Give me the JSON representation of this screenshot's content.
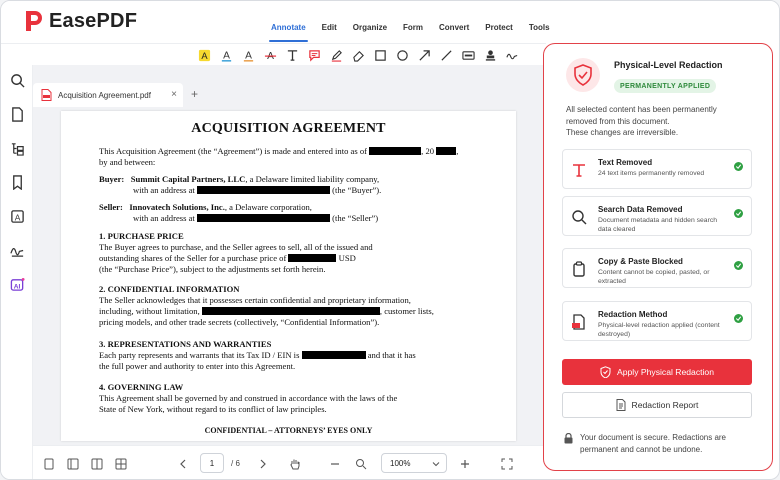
{
  "app": {
    "name": "EasePDF"
  },
  "menu": [
    {
      "label": "Annotate",
      "active": true
    },
    {
      "label": "Edit"
    },
    {
      "label": "Organize"
    },
    {
      "label": "Form"
    },
    {
      "label": "Convert"
    },
    {
      "label": "Protect"
    },
    {
      "label": "Tools"
    }
  ],
  "tab": {
    "label": "Acquisition Agreement.pdf",
    "close": "×",
    "add": "+"
  },
  "doc": {
    "title": "ACQUISITION AGREEMENT",
    "intro1a": "This Acquisition Agreement (the “Agreement”) is made and entered into as of",
    "intro1b": ", 20",
    "intro1c": ",",
    "intro2": "by and between:",
    "buyer_label": "Buyer:",
    "buyer_name": "Summit Capital Partners, LLC",
    "buyer_desc": ", a Delaware limited liability company,",
    "buyer_addr_a": "with an address at",
    "buyer_addr_b": "(the “Buyer”).",
    "seller_label": "Seller:",
    "seller_name": "Innovatech Solutions, Inc.",
    "seller_desc": ", a Delaware corporation,",
    "seller_addr_a": "with an address at",
    "seller_addr_b": "(the “Seller”)",
    "s1_title": "1. PURCHASE PRICE",
    "s1_l1": "The Buyer agrees to purchase, and the Seller agrees to sell, all of the issued and",
    "s1_l2a": "outstanding shares of the Seller for a purchase price of",
    "s1_l2b": "USD",
    "s1_l3": "(the “Purchase Price”), subject to the adjustments set forth herein.",
    "s2_title": "2. CONFIDENTIAL INFORMATION",
    "s2_l1": "The Seller acknowledges that it possesses certain confidential and proprietary information,",
    "s2_l2a": "including, without limitation,",
    "s2_l2b": ", customer lists,",
    "s2_l3": "pricing models, and other trade secrets (collectively, “Confidential Information”).",
    "s3_title": "3. REPRESENTATIONS AND WARRANTIES",
    "s3_l1a": "Each party represents and warrants that its Tax ID / EIN is",
    "s3_l1b": "and that it has",
    "s3_l2": "the full power and authority to enter into this Agreement.",
    "s4_title": "4. GOVERNING LAW",
    "s4_l1": "This Agreement shall be governed by and construed in accordance with the laws of the",
    "s4_l2": "State of New York, without regard to its conflict of law principles.",
    "footer": "CONFIDENTIAL – ATTORNEYS’ EYES ONLY"
  },
  "pager": {
    "current": "1",
    "total": "/ 6"
  },
  "zoom": {
    "value": "100%"
  },
  "panel": {
    "title": "Physical-Level Redaction",
    "badge": "PERMANENTLY APPLIED",
    "desc1": "All selected content has been permanently",
    "desc2": "removed from this document.",
    "desc3": "These changes are irreversible.",
    "cards": [
      {
        "title": "Text Removed",
        "sub": "24 text items permanently removed"
      },
      {
        "title": "Search Data Removed",
        "sub": "Document metadata and hidden search data cleared"
      },
      {
        "title": "Copy & Paste Blocked",
        "sub": "Content cannot be copied, pasted, or extracted"
      },
      {
        "title": "Redaction Method",
        "sub": "Physical-level redaction applied (content destroyed)"
      }
    ],
    "apply_label": "Apply Physical Redaction",
    "report_label": "Redaction Report",
    "secure_text": "Your document is secure. Redactions are permanent and cannot be undone."
  },
  "colors": {
    "accent": "#2f6fd6",
    "danger": "#e8323c",
    "success": "#2fa043"
  }
}
